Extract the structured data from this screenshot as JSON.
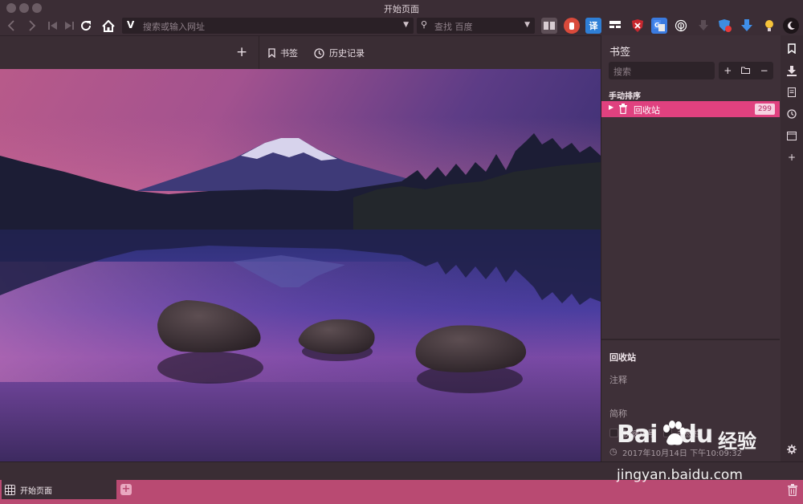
{
  "window": {
    "title": "开始页面"
  },
  "toolbar": {
    "url_placeholder": "搜索或输入网址",
    "search_placeholder": "查找 百度",
    "logo_letter": "V",
    "extensions": [
      "reader-icon",
      "adblock-icon",
      "translate-icon",
      "grab-icon",
      "ublock-icon",
      "google-translate-icon",
      "fingerprint-icon",
      "download-arrow-icon",
      "shield-badge-icon",
      "download-blue-icon",
      "bulb-icon",
      "moon-icon"
    ],
    "translate_label": "译"
  },
  "subbar": {
    "add_label": "+",
    "bookmarks_label": "书签",
    "history_label": "历史记录"
  },
  "panel": {
    "title": "书签",
    "search_placeholder": "搜索",
    "sort_label": "手动排序",
    "trash": {
      "name": "回收站",
      "count": "299"
    },
    "detail": {
      "title": "回收站",
      "note_label": "注释",
      "nickname_label": "简称",
      "speed_dial_label": "快速拨号",
      "bookmarks_bar_label": "书签栏",
      "date": "2017年10月14日 下午10:09:32"
    }
  },
  "tabs": [
    {
      "label": "开始页面",
      "active": true
    }
  ],
  "watermark": {
    "brand": "Bai",
    "brand2": "du",
    "product": "经验",
    "url": "jingyan.baidu.com"
  },
  "colors": {
    "accent": "#e0417f",
    "tabbar": "#b94a72",
    "chrome": "#3b2d35"
  }
}
